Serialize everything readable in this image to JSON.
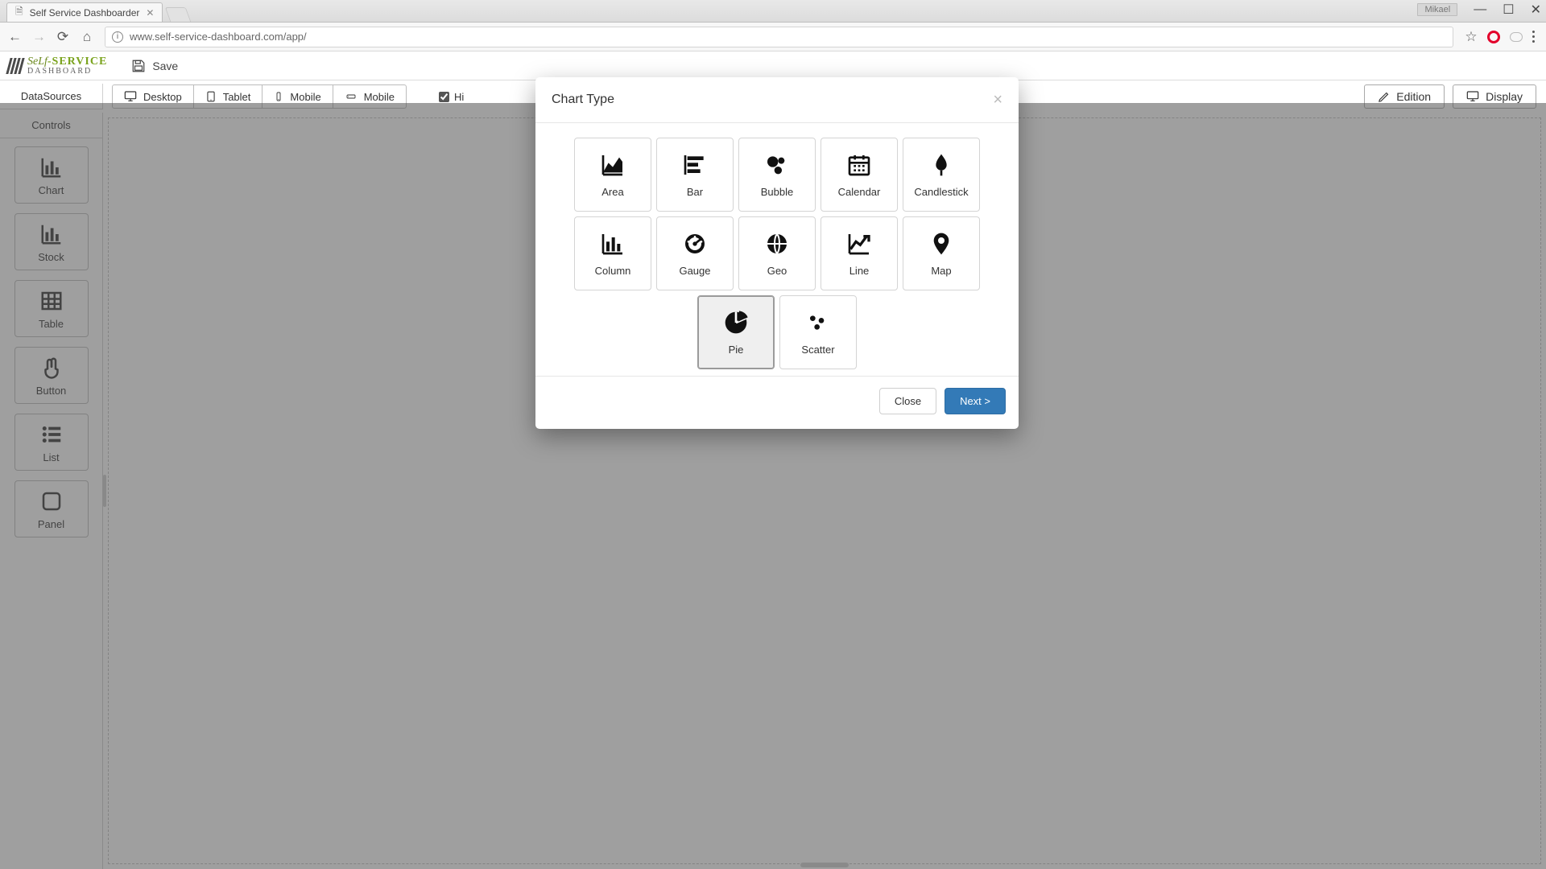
{
  "browser": {
    "tab_title": "Self Service Dashboarder",
    "user_chip": "Mikael",
    "url": "www.self-service-dashboard.com/app/"
  },
  "brand": {
    "line1_a": "SeLf",
    "line1_b": "-SERVICE",
    "line2": "DASHBOARD"
  },
  "header": {
    "save_label": "Save"
  },
  "left_tabs": {
    "datasources": "DataSources",
    "controls": "Controls"
  },
  "device_tabs": [
    "Desktop",
    "Tablet",
    "Mobile",
    "Mobile"
  ],
  "hide_label": "Hi",
  "right_buttons": {
    "edition": "Edition",
    "display": "Display"
  },
  "sidebar": {
    "items": [
      {
        "label": "Chart",
        "icon": "column"
      },
      {
        "label": "Stock",
        "icon": "column"
      },
      {
        "label": "Table",
        "icon": "table"
      },
      {
        "label": "Button",
        "icon": "hand"
      },
      {
        "label": "List",
        "icon": "list"
      },
      {
        "label": "Panel",
        "icon": "panel"
      }
    ]
  },
  "modal": {
    "title": "Chart Type",
    "selected": "Pie",
    "types": [
      "Area",
      "Bar",
      "Bubble",
      "Calendar",
      "Candlestick",
      "Column",
      "Gauge",
      "Geo",
      "Line",
      "Map",
      "Pie",
      "Scatter"
    ],
    "close_label": "Close",
    "next_label": "Next >"
  }
}
